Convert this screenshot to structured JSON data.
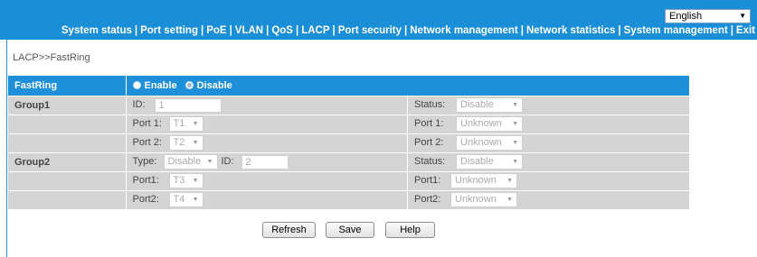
{
  "header": {
    "language": "English",
    "nav": [
      "System status",
      "Port setting",
      "PoE",
      "VLAN",
      "QoS",
      "LACP",
      "Port security",
      "Network management",
      "Network statistics",
      "System management",
      "Exit"
    ],
    "separator": "|"
  },
  "breadcrumb": "LACP>>FastRing",
  "fastring": {
    "label": "FastRing",
    "enable_label": "Enable",
    "disable_label": "Disable",
    "selected": "Disable"
  },
  "group1": {
    "label": "Group1",
    "id_label": "ID:",
    "id_value": "1",
    "status_label": "Status:",
    "status_value": "Disable",
    "port1_label": "Port 1:",
    "port1_value": "T1",
    "port1_status_label": "Port 1:",
    "port1_status_value": "Unknown",
    "port2_label": "Port 2:",
    "port2_value": "T2",
    "port2_status_label": "Port 2:",
    "port2_status_value": "Unknown"
  },
  "group2": {
    "label": "Group2",
    "type_label": "Type:",
    "type_value": "Disable",
    "id_label": "ID:",
    "id_value": "2",
    "status_label": "Status:",
    "status_value": "Disable",
    "port1_label": "Port1:",
    "port1_value": "T3",
    "port1_status_label": "Port1:",
    "port1_status_value": "Unknown",
    "port2_label": "Port2:",
    "port2_value": "T4",
    "port2_status_label": "Port2:",
    "port2_status_value": "Unknown"
  },
  "buttons": {
    "refresh": "Refresh",
    "save": "Save",
    "help": "Help"
  },
  "colors": {
    "header_bg": "#1a8ed6",
    "table_header_bg": "#1e8fd9",
    "row_bg": "#d4d4d4"
  }
}
